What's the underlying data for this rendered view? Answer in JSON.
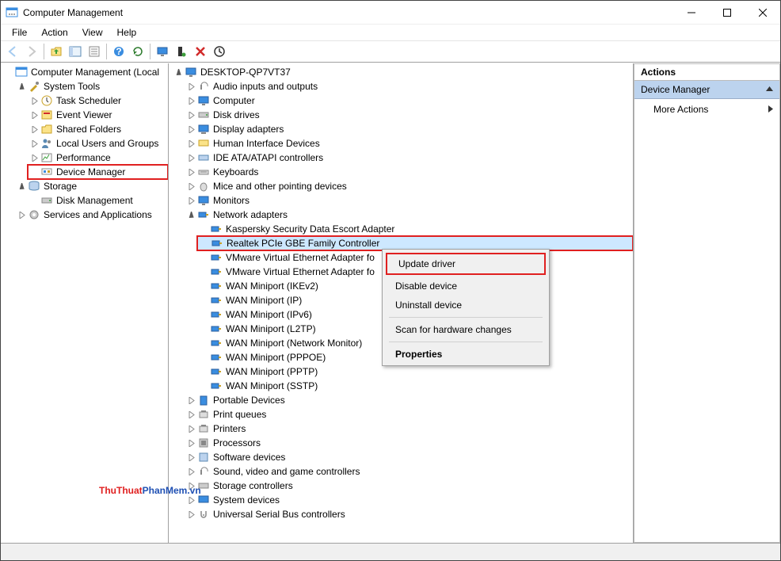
{
  "window": {
    "title": "Computer Management"
  },
  "menus": [
    "File",
    "Action",
    "View",
    "Help"
  ],
  "left_tree": {
    "root": "Computer Management (Local",
    "system_tools": "System Tools",
    "task_scheduler": "Task Scheduler",
    "event_viewer": "Event Viewer",
    "shared_folders": "Shared Folders",
    "local_users": "Local Users and Groups",
    "performance": "Performance",
    "device_manager": "Device Manager",
    "storage": "Storage",
    "disk_management": "Disk Management",
    "services_apps": "Services and Applications"
  },
  "devices": {
    "root": "DESKTOP-QP7VT37",
    "cats": [
      "Audio inputs and outputs",
      "Computer",
      "Disk drives",
      "Display adapters",
      "Human Interface Devices",
      "IDE ATA/ATAPI controllers",
      "Keyboards",
      "Mice and other pointing devices",
      "Monitors"
    ],
    "net_label": "Network adapters",
    "net": [
      "Kaspersky Security Data Escort Adapter",
      "Realtek PCIe GBE Family Controller",
      "VMware Virtual Ethernet Adapter fo",
      "VMware Virtual Ethernet Adapter fo",
      "WAN Miniport (IKEv2)",
      "WAN Miniport (IP)",
      "WAN Miniport (IPv6)",
      "WAN Miniport (L2TP)",
      "WAN Miniport (Network Monitor)",
      "WAN Miniport (PPPOE)",
      "WAN Miniport (PPTP)",
      "WAN Miniport (SSTP)"
    ],
    "cats2": [
      "Portable Devices",
      "Print queues",
      "Printers",
      "Processors",
      "Software devices",
      "Sound, video and game controllers",
      "Storage controllers",
      "System devices",
      "Universal Serial Bus controllers"
    ]
  },
  "ctx": {
    "update": "Update driver",
    "disable": "Disable device",
    "uninstall": "Uninstall device",
    "scan": "Scan for hardware changes",
    "props": "Properties"
  },
  "actions": {
    "header": "Actions",
    "devmgr": "Device Manager",
    "more": "More Actions"
  },
  "watermark_a": "ThuThuat",
  "watermark_b": "PhanMem.vn"
}
